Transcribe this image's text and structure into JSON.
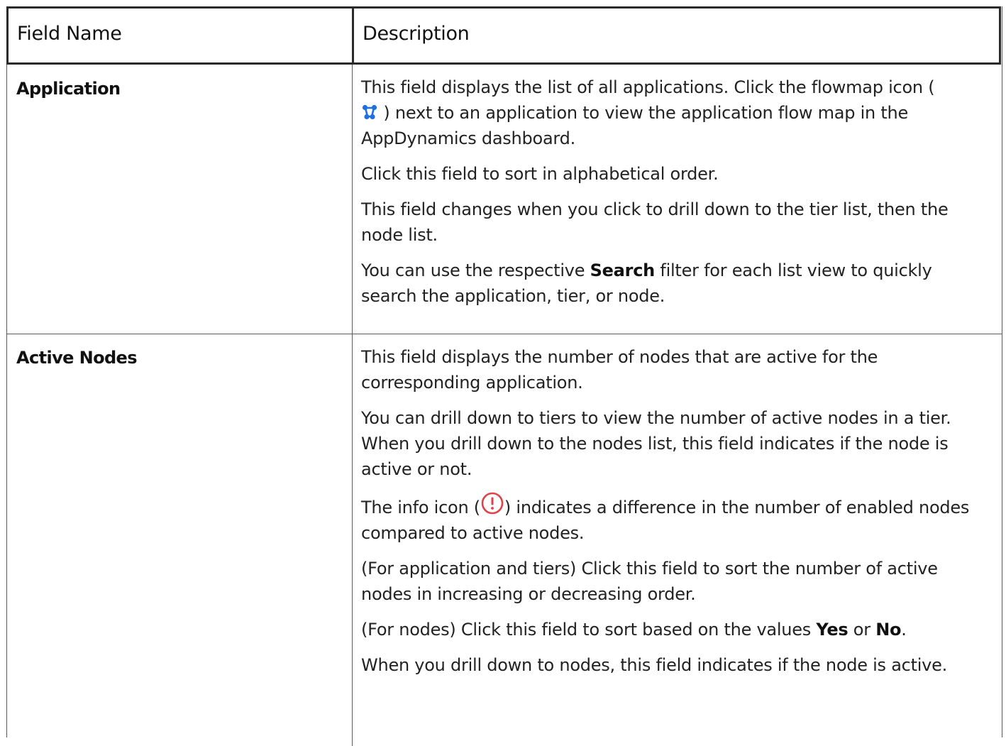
{
  "table": {
    "headers": [
      "Field Name",
      "Description"
    ],
    "rows": [
      {
        "field": "Application",
        "description": [
          {
            "parts": [
              "This field displays the list of all applications. Click the flowmap icon (",
              ") next to an application to view the application flow map in the AppDynamics dashboard."
            ],
            "icon": "flowmap-icon"
          },
          "Click this field to sort in alphabetical order.",
          "This field changes when you click to drill down to the tier list, then the node list.",
          {
            "parts": [
              "You can use the respective ",
              "Search",
              " filter for each list view to quickly search the application, tier, or node."
            ]
          }
        ]
      },
      {
        "field": "Active Nodes",
        "description": [
          "This field displays the number of nodes that are active for the corresponding application.",
          "You can drill down to tiers to view the number of active nodes in a tier. When you drill down to the nodes list, this field indicates if the node is active or not.",
          {
            "parts": [
              "The info icon (",
              ") indicates a difference in the number of enabled nodes compared to active nodes."
            ],
            "icon": "info-icon"
          },
          "(For application and tiers) Click this field to sort the number of active nodes in increasing or decreasing order.",
          {
            "parts": [
              "(For nodes) Click this field to sort based on the values ",
              "Yes",
              " or ",
              "No",
              "."
            ]
          },
          "When you drill down to nodes, this field indicates if the node is active."
        ]
      }
    ]
  },
  "colors": {
    "flowmap_icon": "#1e6fe0",
    "info_icon": "#e0424a",
    "border": "#2a2a2a"
  }
}
